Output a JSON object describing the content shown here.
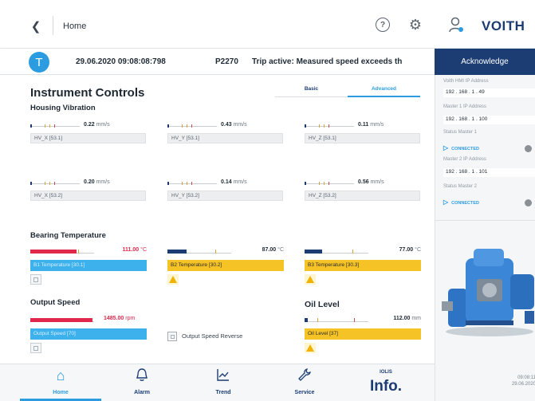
{
  "header": {
    "back_icon": "chevron-left-icon",
    "title": "Home",
    "logo": "VOITH"
  },
  "alarm": {
    "badge": "T",
    "datetime": "29.06.2020 09:08:08:798",
    "code": "P2270",
    "message": "Trip active: Measured speed exceeds th",
    "acknowledge": "Acknowledge"
  },
  "main": {
    "title": "Instrument Controls",
    "tabs": [
      "Basic",
      "Advanced"
    ],
    "active_tab": "Advanced",
    "housing_vibration": {
      "title": "Housing Vibration",
      "gauges": [
        {
          "value": "0.22",
          "unit": "mm/s",
          "label": "HV_X [53.1]"
        },
        {
          "value": "0.43",
          "unit": "mm/s",
          "label": "HV_Y [53.1]"
        },
        {
          "value": "0.11",
          "unit": "mm/s",
          "label": "HV_Z [53.1]"
        },
        {
          "value": "0.20",
          "unit": "mm/s",
          "label": "HV_X [53.2]"
        },
        {
          "value": "0.14",
          "unit": "mm/s",
          "label": "HV_Y [53.2]"
        },
        {
          "value": "0.56",
          "unit": "mm/s",
          "label": "HV_Z [53.2]"
        }
      ]
    },
    "bearing_temperature": {
      "title": "Bearing Temperature",
      "gauges": [
        {
          "value": "111.00",
          "unit": "°C",
          "label": "B1 Temperature [30.1]",
          "fill_color": "#e0284a",
          "fill_fraction": 0.72,
          "plate": "blue",
          "indicator": "grey"
        },
        {
          "value": "87.00",
          "unit": "°C",
          "label": "B2 Temperature [30.2]",
          "fill_color": "#1b3d73",
          "fill_fraction": 0.3,
          "plate": "yellow",
          "indicator": "warn"
        },
        {
          "value": "77.00",
          "unit": "°C",
          "label": "B3 Temperature [30.3]",
          "fill_color": "#1b3d73",
          "fill_fraction": 0.28,
          "plate": "yellow",
          "indicator": "warn"
        }
      ]
    },
    "output_speed": {
      "title": "Output Speed",
      "value": "1485.00",
      "unit": "rpm",
      "label": "Output Speed [70]",
      "fill_color": "#e0284a",
      "fill_fraction": 0.98,
      "reverse_label": "Output Speed Reverse"
    },
    "oil_level": {
      "title": "Oil Level",
      "value": "112.00",
      "unit": "mm",
      "label": "Oil Level [37]",
      "fill_color": "#1b3d73",
      "fill_fraction": 0.05
    }
  },
  "right_panel": {
    "hmi_ip_label": "Voith HMI IP Address",
    "hmi_ip": "192 . 168 .   1 . 49",
    "master1_ip_label": "Master 1 IP Address",
    "master1_ip": "192 . 168 .   1 . 100",
    "status_master1_label": "Status Master 1",
    "status_master1": "CONNECTED",
    "master2_ip_label": "Master 2 IP Address",
    "master2_ip": "192 . 168 .   1 . 101",
    "status_master2_label": "Status Master 2",
    "status_master2": "CONNECTED",
    "time": "09:08:11",
    "date": "29.06.2020"
  },
  "nav": {
    "home": "Home",
    "alarm": "Alarm",
    "trend": "Trend",
    "service": "Service",
    "iolis": "IOLIS",
    "info": "Info."
  },
  "colors": {
    "navy": "#1b3d73",
    "accent_blue": "#2c9ce0",
    "plate_blue": "#3db1ec",
    "warning_yellow": "#f5c326",
    "alarm_red": "#e0284a"
  }
}
